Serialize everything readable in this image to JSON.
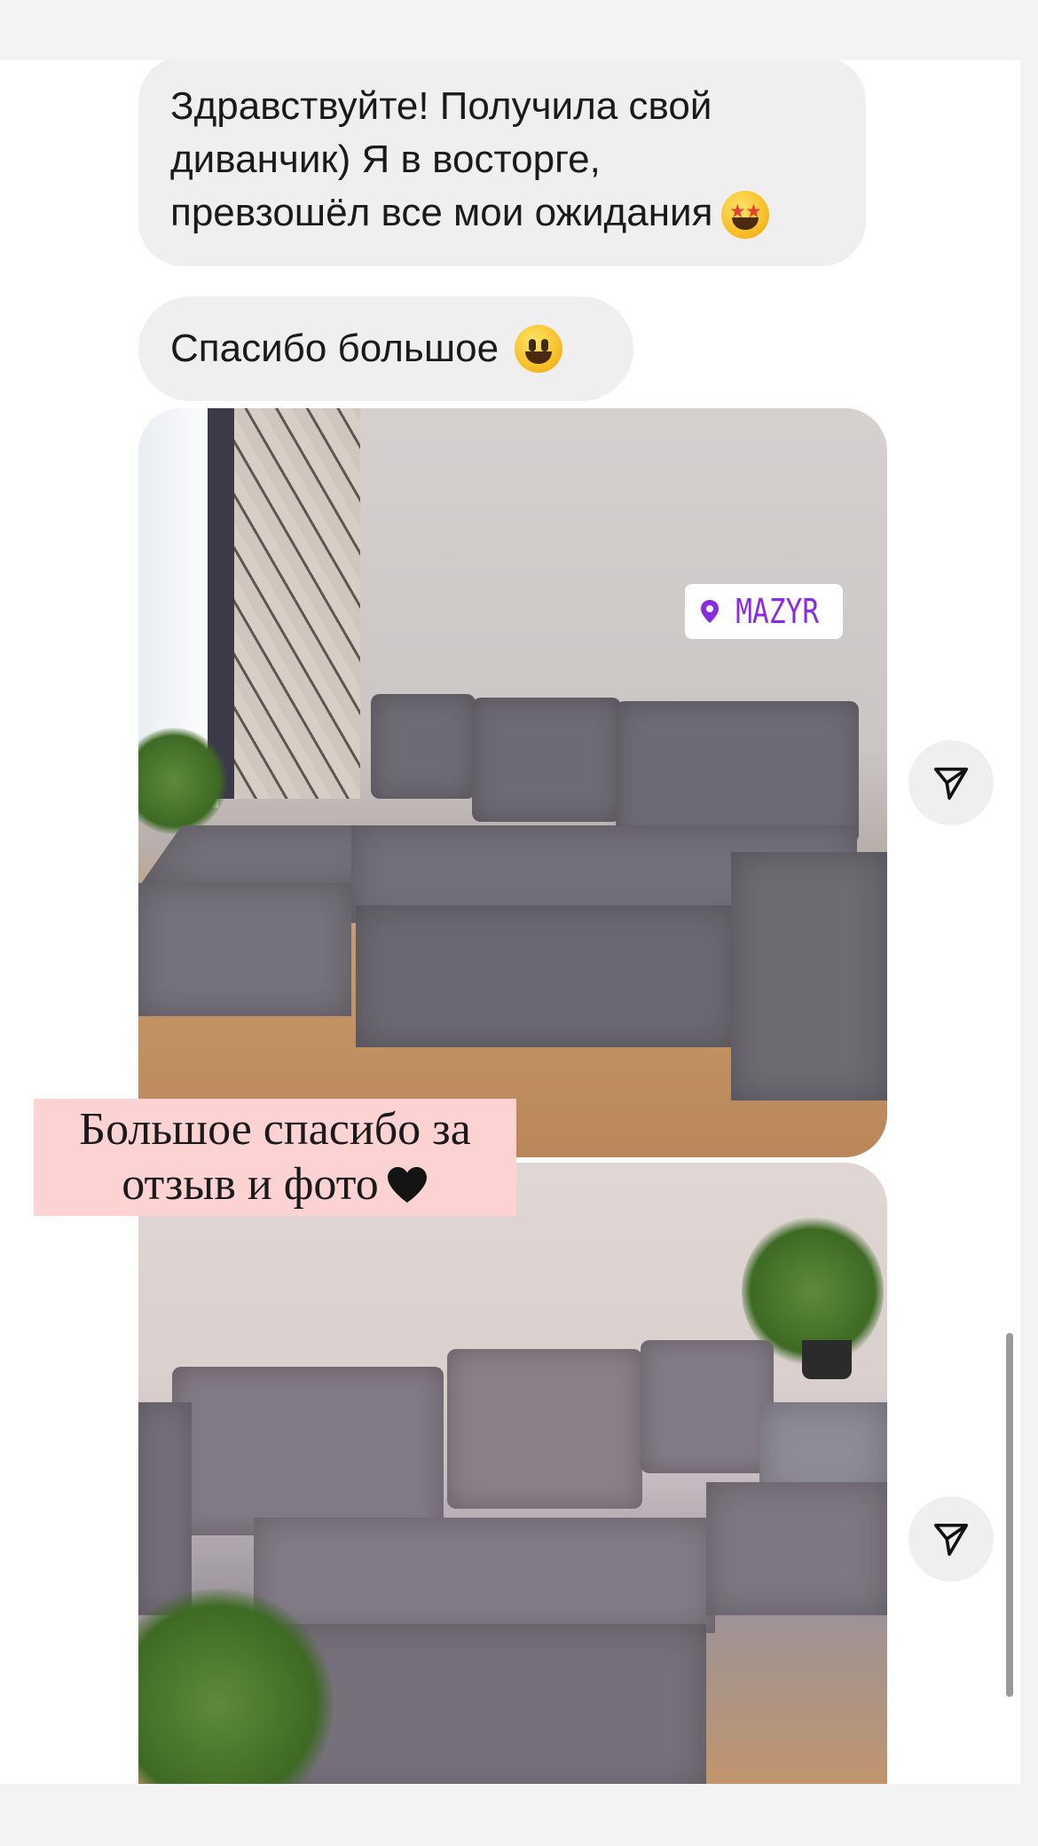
{
  "messages": {
    "message_1": {
      "lines": [
        "Здравствуйте! Получила свой",
        "диванчик) Я в восторге,",
        "превзошёл все мои ожидания"
      ],
      "emoji": "star-struck-emoji"
    },
    "message_2": {
      "text": "Спасибо большое",
      "emoji": "grinning-face-emoji"
    }
  },
  "photo_1": {
    "location_sticker": "MAZYR"
  },
  "caption": {
    "line1": "Большое спасибо за",
    "line2": "отзыв и фото",
    "emoji": "black-heart-emoji"
  },
  "icons": {
    "share": "paper-plane-icon",
    "location": "location-pin-icon"
  },
  "colors": {
    "bubble": "#efefef",
    "caption_bg": "#fdd2d2",
    "location_text": "#8a2be2"
  }
}
